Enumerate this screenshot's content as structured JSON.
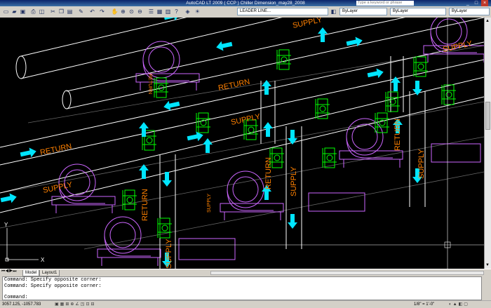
{
  "title_bar": {
    "title": "AutoCAD LT 2009 ( CCP ) Chiller Dimension_may28_2008",
    "search_placeholder": "Type a keyword or phrase"
  },
  "toolbar": {
    "layer_dropdown": "LEADER LINE...",
    "color_dropdown": "ByLayer",
    "linetype_dropdown": "ByLayer",
    "lineweight_dropdown": "ByLayer"
  },
  "drawing": {
    "return_label": "RETURN",
    "supply_label": "SUPPLY",
    "ucs_x": "X",
    "ucs_y": "Y"
  },
  "tabs": [
    "Model",
    "Layout1"
  ],
  "command_history": [
    "Command: Specify opposite corner:",
    "Command: Specify opposite corner:",
    "Command:"
  ],
  "status": {
    "coordinates": "3057.125, -1057.783",
    "scale": "1/8\" = 1'-0\""
  },
  "colors": {
    "background": "#000000",
    "pipe_outline": "#ffffff",
    "equipment": "#cc66ff",
    "valves": "#00ff00",
    "flow_arrows": "#00e5ff",
    "labels": "#ff8000"
  },
  "icons": [
    "new-icon",
    "open-icon",
    "save-icon",
    "print-icon",
    "undo-icon",
    "redo-icon",
    "pan-icon",
    "zoom-icon",
    "properties-icon",
    "layer-icon"
  ]
}
